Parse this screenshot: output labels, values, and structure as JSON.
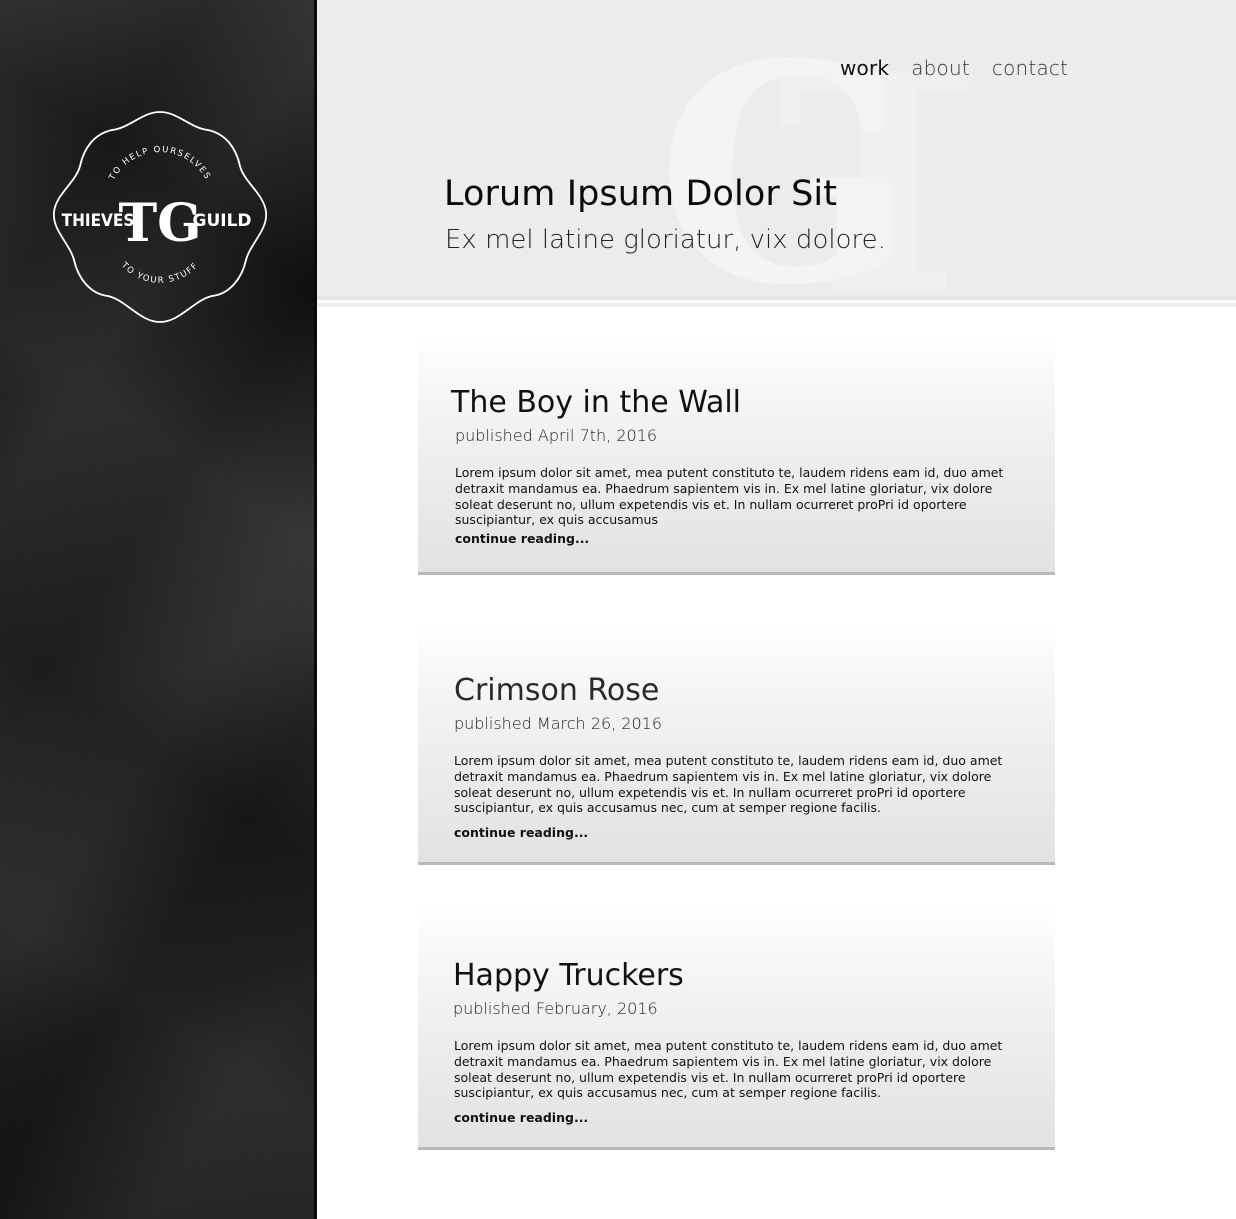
{
  "sidebar": {
    "logo": {
      "top_arc": "TO HELP OURSELVES",
      "left_word": "THIEVES",
      "right_word": "GUILD",
      "bottom_arc": "TO YOUR STUFF",
      "monogram": "TG"
    }
  },
  "nav": {
    "items": [
      {
        "label": "work",
        "active": true
      },
      {
        "label": "about",
        "active": false
      },
      {
        "label": "contact",
        "active": false
      }
    ]
  },
  "hero": {
    "title": "Lorum Ipsum Dolor Sit",
    "subtitle": "Ex mel latine gloriatur, vix dolore."
  },
  "posts": [
    {
      "title": "The Boy in the Wall",
      "date": "published April 7th, 2016",
      "body": "Lorem ipsum dolor sit amet, mea putent constituto te, laudem ridens eam id, duo amet detraxit mandamus ea. Phaedrum sapientem vis in. Ex mel latine gloriatur, vix dolore soleat deserunt no, ullum expetendis vis et. In nullam ocurreret proPri id oportere suscipiantur, ex quis accusamus",
      "link": "continue reading..."
    },
    {
      "title": "Crimson Rose",
      "date": "published March 26, 2016",
      "body": "Lorem ipsum dolor sit amet, mea putent constituto te, laudem ridens eam id, duo amet detraxit mandamus ea. Phaedrum sapientem vis in. Ex mel latine gloriatur, vix dolore soleat deserunt no, ullum expetendis vis et. In nullam ocurreret proPri id oportere suscipiantur, ex quis accusamus nec, cum at semper regione facilis.",
      "link": "continue reading..."
    },
    {
      "title": "Happy Truckers",
      "date": "published February, 2016",
      "body": "Lorem ipsum dolor sit amet, mea putent constituto te, laudem ridens eam id, duo amet detraxit mandamus ea. Phaedrum sapientem vis in. Ex mel latine gloriatur, vix dolore soleat deserunt no, ullum expetendis vis et. In nullam ocurreret proPri id oportere suscipiantur, ex quis accusamus nec, cum at semper regione facilis.",
      "link": "continue reading..."
    }
  ],
  "colors": {
    "sidebar_bg": "#1a1a1a",
    "header_bg": "#ececec",
    "card_border": "#b9b9b9",
    "text": "#111111"
  }
}
